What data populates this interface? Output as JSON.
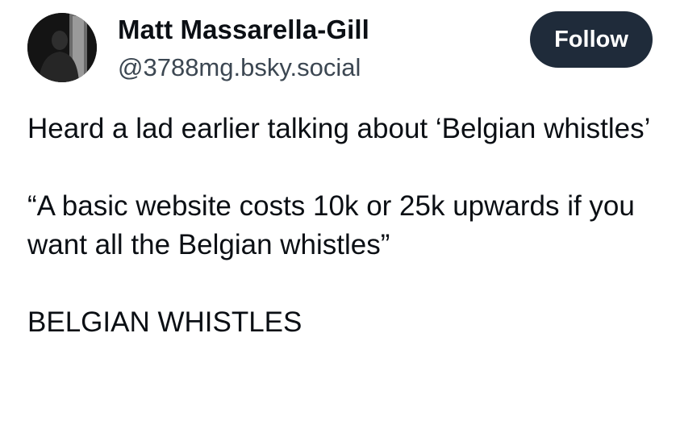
{
  "author": {
    "name": "Matt Massarella-Gill",
    "handle": "@3788mg.bsky.social"
  },
  "follow_label": "Follow",
  "post": {
    "paragraphs": [
      "Heard a lad earlier talking about ‘Belgian whistles’",
      "“A basic website costs 10k or 25k upwards if you want all the Belgian whistles”",
      "BELGIAN WHISTLES"
    ]
  },
  "colors": {
    "follow_bg": "#1f2b3a",
    "handle": "#3c4752",
    "text": "#0b0f14"
  }
}
